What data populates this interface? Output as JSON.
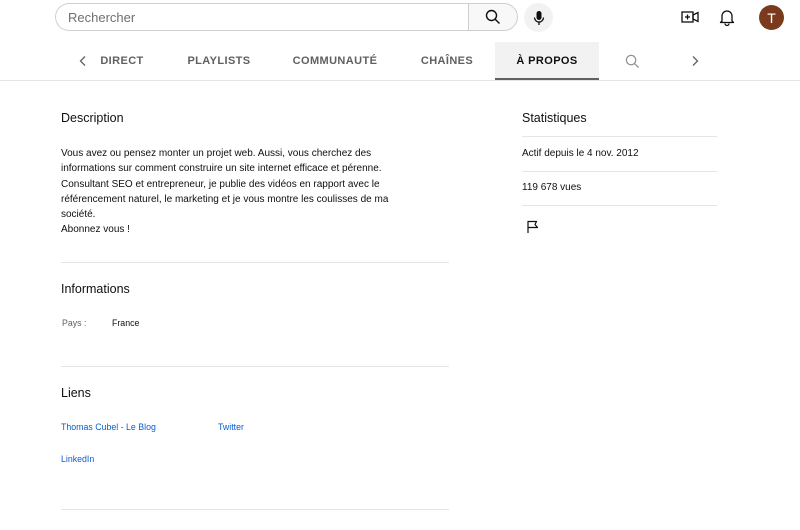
{
  "search": {
    "placeholder": "Rechercher"
  },
  "header": {
    "avatar_letter": "T",
    "icons": [
      "create-video-icon",
      "notifications-bell-icon"
    ]
  },
  "tabs": [
    {
      "label": "DIRECT"
    },
    {
      "label": "PLAYLISTS"
    },
    {
      "label": "COMMUNAUTÉ"
    },
    {
      "label": "CHAÎNES"
    },
    {
      "label": "À PROPOS",
      "active": true
    }
  ],
  "about": {
    "description_title": "Description",
    "description_text": "Vous avez ou pensez monter un projet web. Aussi, vous cherchez des\ninformations sur comment construire un site internet efficace et pérenne.\nConsultant SEO et entrepreneur, je publie des vidéos en rapport avec le\nréférencement naturel, le marketing et je vous montre les coulisses de ma\nsociété.\nAbonnez vous !",
    "info_title": "Informations",
    "country_label": "Pays :",
    "country_value": "France",
    "links_title": "Liens",
    "links": [
      "Thomas Cubel - Le Blog",
      "Twitter",
      "LinkedIn"
    ]
  },
  "stats": {
    "title": "Statistiques",
    "joined": "Actif depuis le 4 nov. 2012",
    "views": "119 678 vues"
  },
  "colors": {
    "link": "#065fd4",
    "avatar": "#7a3a1e",
    "tab_active_bg": "#f2f2f2"
  }
}
